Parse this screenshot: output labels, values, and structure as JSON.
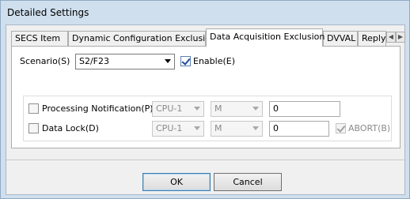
{
  "window": {
    "title": "Detailed Settings"
  },
  "tabs": [
    {
      "label": "SECS Item"
    },
    {
      "label": "Dynamic Configuration Exclusion"
    },
    {
      "label": "Data Acquisition Exclusion"
    },
    {
      "label": "DVVAL"
    },
    {
      "label": "Reply"
    }
  ],
  "tab_scroll": {
    "left_icon": "scroll-left-icon",
    "right_icon": "scroll-right-icon"
  },
  "scenario": {
    "label": "Scenario(S)",
    "value": "S2/F23",
    "enable_label": "Enable(E)",
    "enable_checked": true
  },
  "processing_notification": {
    "label": "Processing Notification(P)",
    "checked": false,
    "cpu": "CPU-1",
    "device": "M",
    "value": "0"
  },
  "data_lock": {
    "label": "Data Lock(D)",
    "checked": false,
    "cpu": "CPU-1",
    "device": "M",
    "value": "0",
    "abort_label": "ABORT(B)",
    "abort_checked": true
  },
  "buttons": {
    "ok": "OK",
    "cancel": "Cancel"
  }
}
